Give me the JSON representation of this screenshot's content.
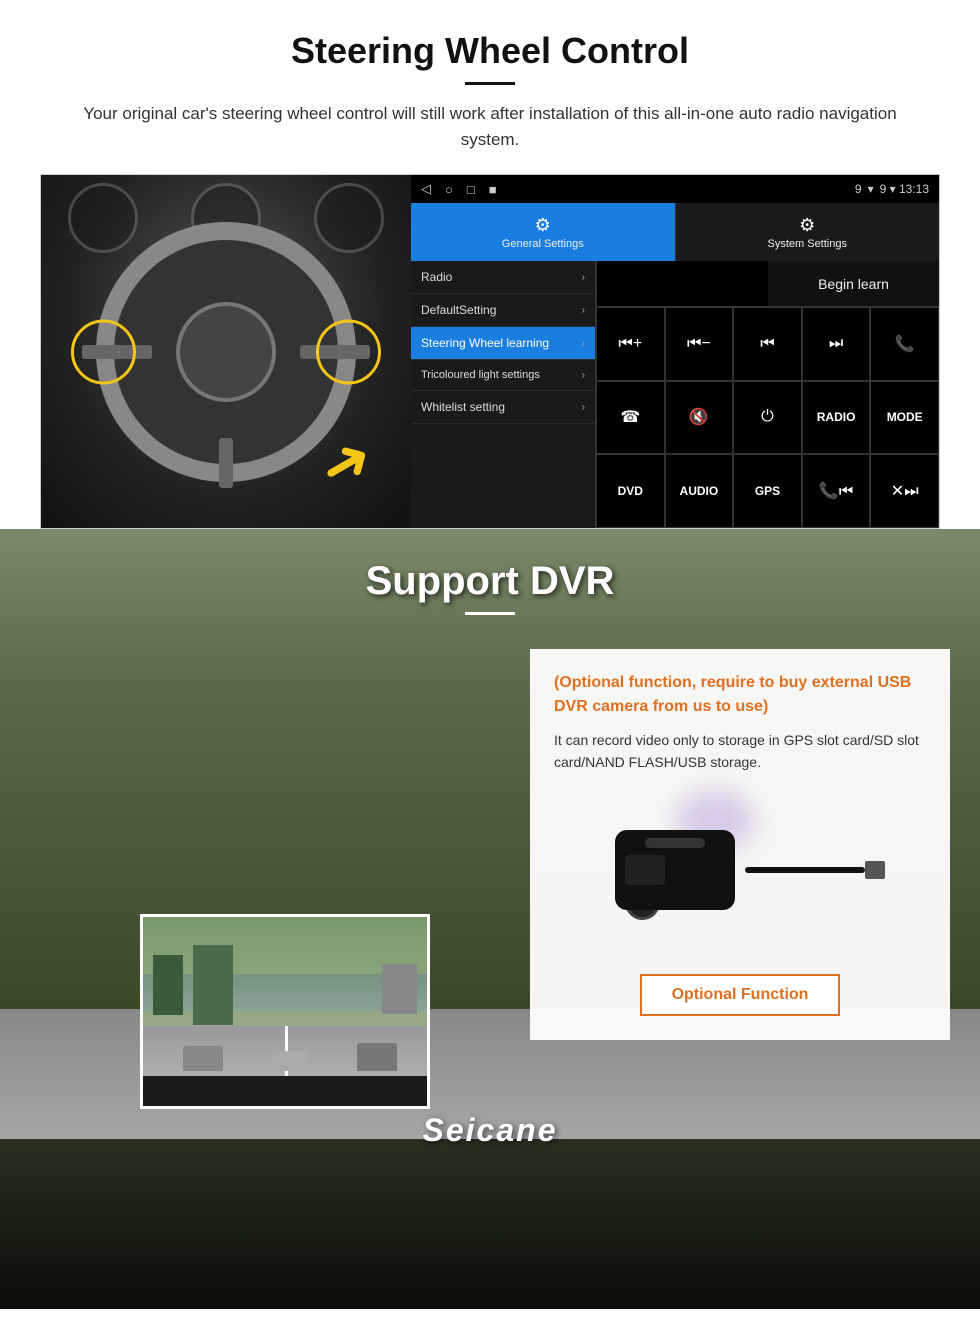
{
  "page": {
    "section1": {
      "title": "Steering Wheel Control",
      "subtitle": "Your original car's steering wheel control will still work after installation of this all-in-one auto radio navigation system.",
      "android_bar": {
        "nav_icons": [
          "◁",
          "○",
          "□",
          "■"
        ],
        "status": "9 ▾ 13:13"
      },
      "tabs": {
        "general": {
          "label": "General Settings",
          "icon": "⚙"
        },
        "system": {
          "label": "System Settings",
          "icon": "🔧"
        }
      },
      "menu_items": [
        {
          "label": "Radio",
          "active": false
        },
        {
          "label": "DefaultSetting",
          "active": false
        },
        {
          "label": "Steering Wheel learning",
          "active": true
        },
        {
          "label": "Tricoloured light settings",
          "active": false
        },
        {
          "label": "Whitelist setting",
          "active": false
        }
      ],
      "begin_learn_label": "Begin learn",
      "control_buttons": [
        "⏮+",
        "⏮-",
        "⏮⏮",
        "⏭⏭",
        "📞",
        "📞✕",
        "🔇×",
        "⏻",
        "RADIO",
        "MODE",
        "DVD",
        "AUDIO",
        "GPS",
        "📞⏮",
        "✕⏭"
      ]
    },
    "section2": {
      "title": "Support DVR",
      "optional_title": "(Optional function, require to buy external USB DVR camera from us to use)",
      "description": "It can record video only to storage in GPS slot card/SD slot card/NAND FLASH/USB storage.",
      "optional_func_label": "Optional Function",
      "seicane_brand": "Seicane"
    }
  }
}
